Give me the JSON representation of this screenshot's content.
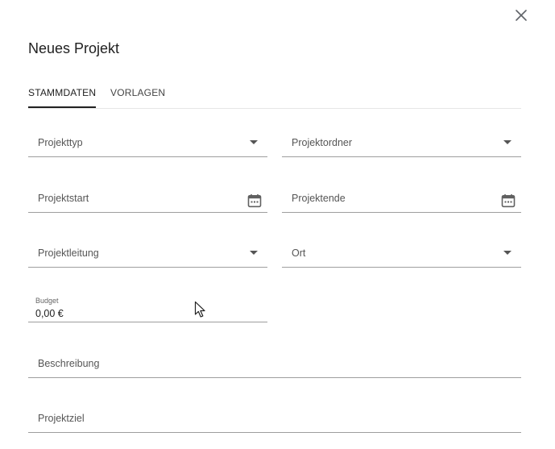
{
  "dialog": {
    "title": "Neues Projekt",
    "close_icon": "close-icon"
  },
  "tabs": [
    {
      "label": "STAMMDATEN",
      "active": true
    },
    {
      "label": "VORLAGEN",
      "active": false
    }
  ],
  "fields": {
    "projekttyp": {
      "label": "Projekttyp",
      "type": "select",
      "icon": "chevron-down-icon"
    },
    "projektordner": {
      "label": "Projektordner",
      "type": "select",
      "icon": "chevron-down-icon"
    },
    "projektstart": {
      "label": "Projektstart",
      "type": "date",
      "icon": "calendar-icon"
    },
    "projektende": {
      "label": "Projektende",
      "type": "date",
      "icon": "calendar-icon"
    },
    "projektleitung": {
      "label": "Projektleitung",
      "type": "select",
      "icon": "chevron-down-icon"
    },
    "ort": {
      "label": "Ort",
      "type": "select",
      "icon": "chevron-down-icon"
    },
    "budget": {
      "label": "Budget",
      "value": "0,00 €"
    },
    "beschreibung": {
      "label": "Beschreibung"
    },
    "projektziel": {
      "label": "Projektziel"
    }
  },
  "colors": {
    "underline": "#9e9e9e",
    "label": "#555555",
    "text": "#212121",
    "divider": "#e6e6e6"
  }
}
